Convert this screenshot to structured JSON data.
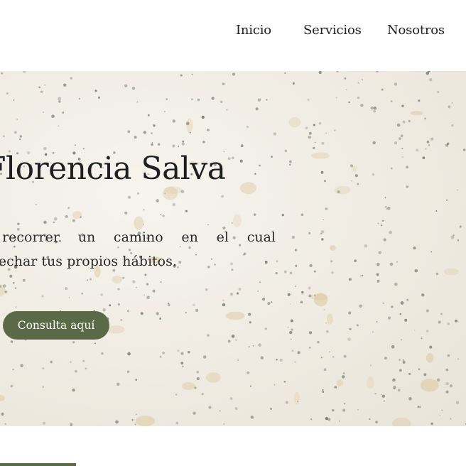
{
  "nav": {
    "items": [
      {
        "label": "Inicio"
      },
      {
        "label": "Servicios"
      },
      {
        "label": "Nosotros"
      }
    ]
  },
  "hero": {
    "title": "Florencia Salva",
    "text_line1": "a recorrer un camino en el cual",
    "text_line2": "cosechar tus propios hábitos.",
    "cta_label": "Consulta aquí"
  },
  "colors": {
    "accent": "#5a6a47",
    "hero_background": "#efebe2",
    "text": "#1f2123"
  }
}
